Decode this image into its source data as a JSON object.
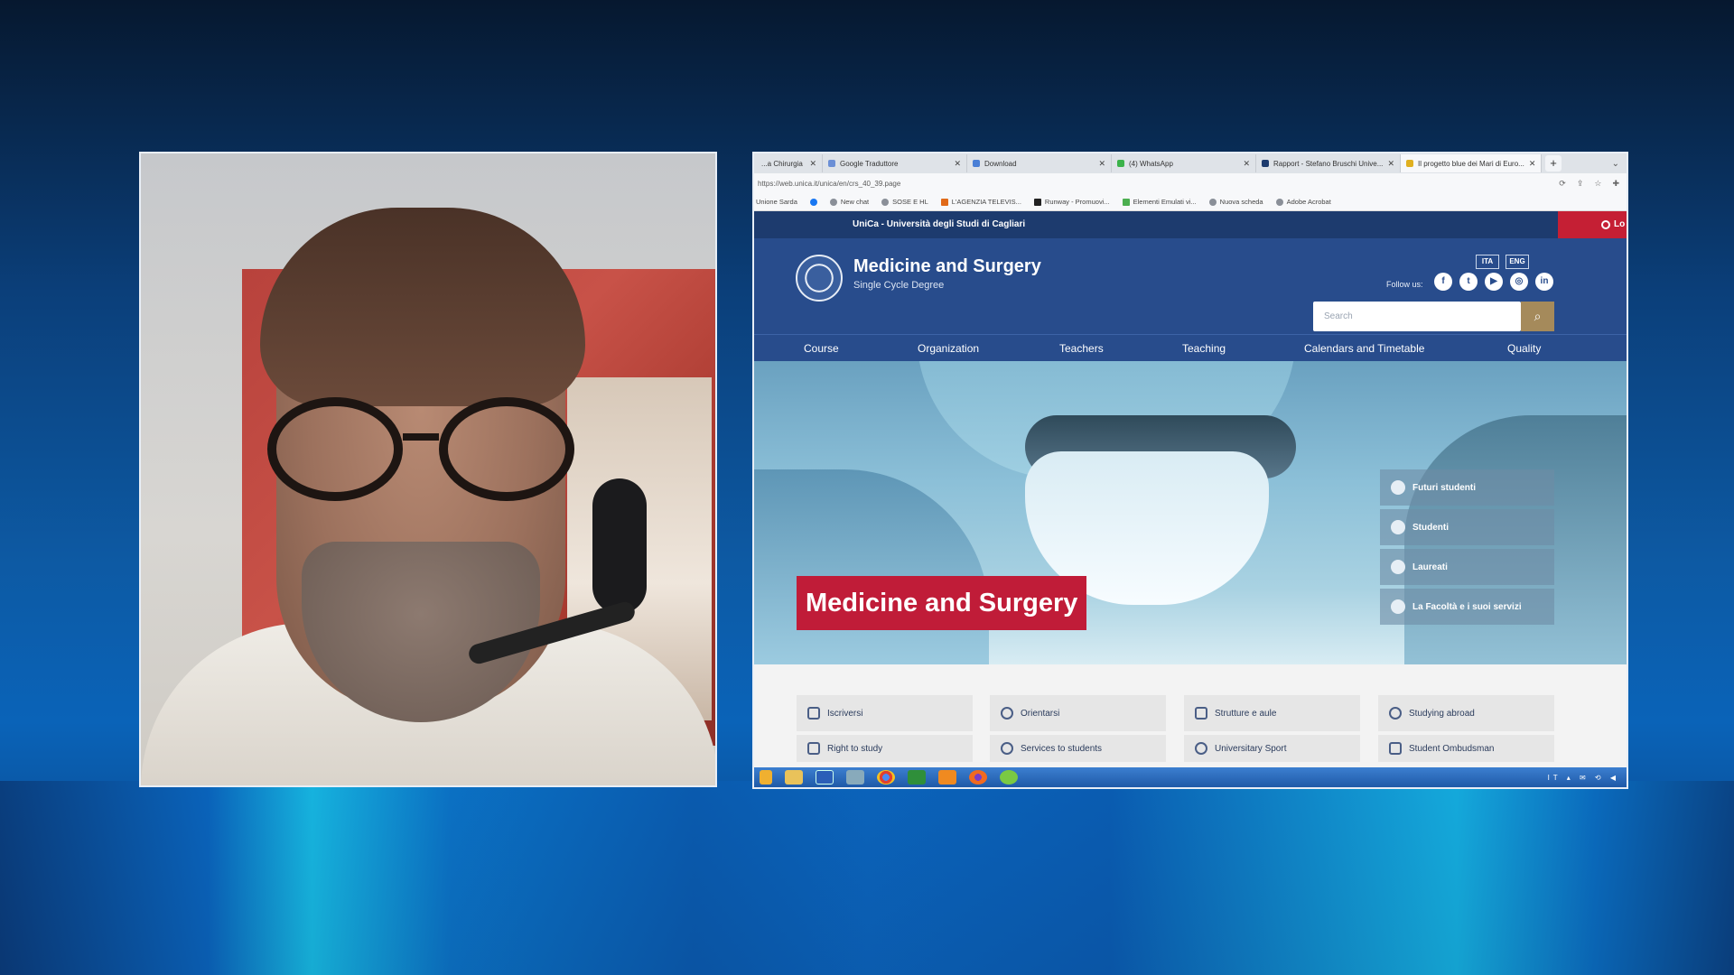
{
  "browser": {
    "tabs": [
      {
        "label": "...a Chirurgia"
      },
      {
        "label": "Google Traduttore"
      },
      {
        "label": "Download"
      },
      {
        "label": "(4) WhatsApp"
      },
      {
        "label": "Rapport - Stefano Bruschi Unive..."
      },
      {
        "label": "Il progetto blue dei Mari di Euro..."
      }
    ],
    "new_tab_label": "+",
    "url": "https://web.unica.it/unica/en/crs_40_39.page",
    "bookmarks": [
      "Unione Sarda",
      "",
      "New chat",
      "SOSE E HL",
      "L'AGENZIA TELEVIS...",
      "Runway - Promuovi...",
      "Elementi Emulati vi...",
      "Nuova scheda",
      "Adobe Acrobat"
    ]
  },
  "site": {
    "university_name": "UniCa - Università degli Studi di Cagliari",
    "login_label": "Lo",
    "title": "Medicine and Surgery",
    "subtitle": "Single Cycle Degree",
    "lang_ita": "ITA",
    "lang_eng": "ENG",
    "follow_label": "Follow us:",
    "social": [
      "f",
      "t",
      "▶",
      "◎",
      "in"
    ],
    "search_placeholder": "Search",
    "nav": [
      "Course",
      "Organization",
      "Teachers",
      "Teaching",
      "Calendars and Timetable",
      "Quality"
    ],
    "hero_title": "Medicine and Surgery",
    "quick_links": [
      "Futuri studenti",
      "Studenti",
      "Laureati",
      "La Facoltà e i suoi servizi"
    ],
    "cards": [
      "Iscriversi",
      "Orientarsi",
      "Strutture e aule",
      "Studying abroad",
      "Right to study",
      "Services to students",
      "Universitary Sport",
      "Student Ombudsman"
    ]
  },
  "taskbar": {
    "tray_text": "IT ▴ ✉ ⟲ ◀"
  },
  "colors": {
    "site_blue": "#284c8c",
    "site_dark": "#1d3b6e",
    "accent_red": "#c01c38",
    "search_gold": "#a58a5b"
  }
}
